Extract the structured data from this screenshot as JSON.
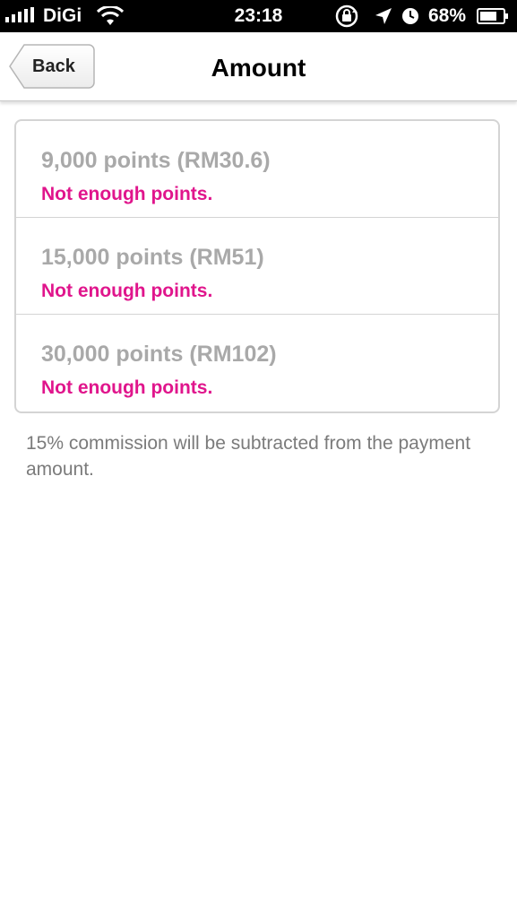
{
  "status_bar": {
    "carrier": "DiGi",
    "time": "23:18",
    "battery_percent": "68%",
    "icons": [
      "signal-icon",
      "wifi-icon",
      "rotation-lock-icon",
      "location-icon",
      "alarm-icon",
      "battery-icon"
    ]
  },
  "nav": {
    "back_label": "Back",
    "title": "Amount"
  },
  "options": [
    {
      "label": "9,000 points (RM30.6)",
      "status": "Not enough points."
    },
    {
      "label": "15,000 points (RM51)",
      "status": "Not enough points."
    },
    {
      "label": "30,000 points (RM102)",
      "status": "Not enough points."
    }
  ],
  "footnote": "15% commission will be subtracted from the payment amount.",
  "colors": {
    "status_warning": "#e0158c",
    "disabled_text": "#a9a9a9",
    "footnote_text": "#7b7b7b"
  }
}
